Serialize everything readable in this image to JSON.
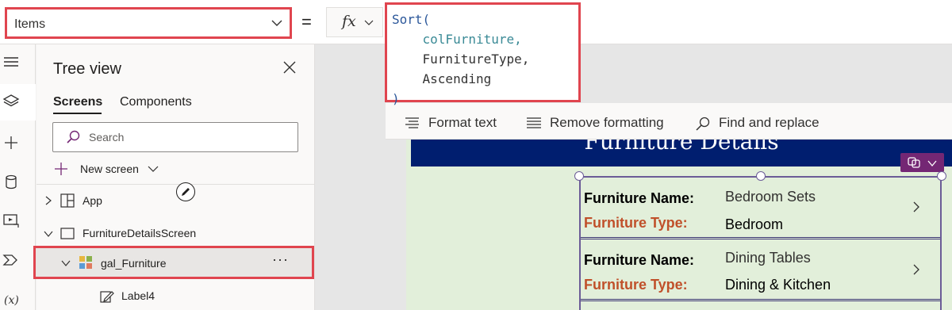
{
  "formula_bar": {
    "property": "Items",
    "equals": "=",
    "fx_label": "fx",
    "code": {
      "line1": "Sort(",
      "line2": "colFurniture,",
      "line3": "FurnitureType,",
      "line4": "Ascending",
      "line5": ")"
    }
  },
  "tree_view": {
    "title": "Tree view",
    "tabs": [
      "Screens",
      "Components"
    ],
    "search_placeholder": "Search",
    "new_screen": "New screen",
    "nodes": {
      "app": "App",
      "screen": "FurnitureDetailsScreen",
      "gallery": "gal_Furniture",
      "label": "Label4"
    },
    "more": "···"
  },
  "format_toolbar": {
    "format_text": "Format text",
    "remove_formatting": "Remove formatting",
    "find_replace": "Find and replace"
  },
  "app_screen": {
    "header_title": "Furniture Details",
    "name_label": "Furniture Name:",
    "type_label": "Furniture Type:",
    "rows": [
      {
        "name": "Bedroom Sets",
        "type": "Bedroom"
      },
      {
        "name": "Dining Tables",
        "type": "Dining & Kitchen"
      }
    ]
  },
  "colors": {
    "highlight_border": "#e0454f",
    "header_bg": "#001e6f",
    "canvas_bg": "#e2efda",
    "type_label": "#c0502a",
    "control_chip": "#742774"
  }
}
